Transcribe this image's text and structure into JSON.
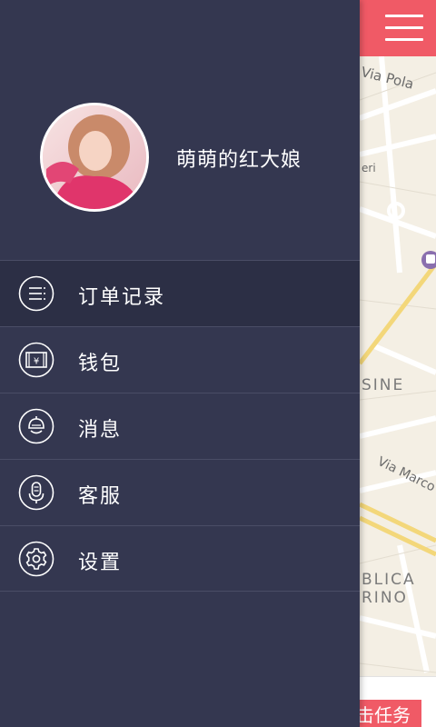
{
  "app": {
    "accent_color": "#f05a66",
    "drawer_color": "#343750"
  },
  "header": {
    "menu_icon": "hamburger-menu-icon"
  },
  "profile": {
    "username": "萌萌的红大娘",
    "avatar_icon": "user-avatar"
  },
  "menu": {
    "items": [
      {
        "label": "订单记录",
        "icon": "list-icon"
      },
      {
        "label": "钱包",
        "icon": "wallet-icon"
      },
      {
        "label": "消息",
        "icon": "message-icon"
      },
      {
        "label": "客服",
        "icon": "microphone-icon"
      },
      {
        "label": "设置",
        "icon": "gear-icon"
      }
    ]
  },
  "map": {
    "labels": {
      "via_pola": "Via Pola",
      "eri": "eri",
      "sine": "SINE",
      "via_marco": "Via Marco",
      "blica": "BLICA",
      "rino": "RINO"
    }
  },
  "footer": {
    "task_button_label": "击任务"
  }
}
